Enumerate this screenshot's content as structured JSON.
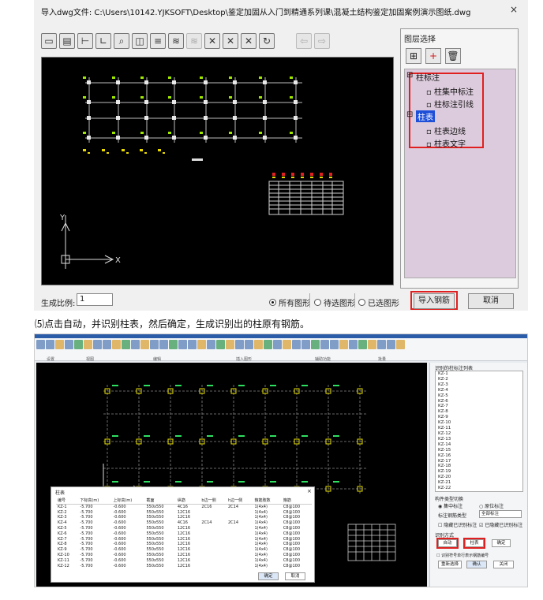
{
  "import_dialog": {
    "title": "导入dwg文件: C:\\Users\\10142.YJKSOFT\\Desktop\\鉴定加固从入门到精通系列课\\混凝土结构鉴定加固案例演示图纸.dwg",
    "close_glyph": "×",
    "layer_panel": {
      "title": "图层选择",
      "tool_icons": [
        "layer-pick-icon",
        "add-icon",
        "delete-icon"
      ],
      "tree": [
        {
          "label": "柱标注",
          "level": 0
        },
        {
          "label": "柱集中标注",
          "level": 1
        },
        {
          "label": "柱标注引线",
          "level": 1
        },
        {
          "label": "柱表",
          "level": 0,
          "selected": true
        },
        {
          "label": "柱表边线",
          "level": 1
        },
        {
          "label": "柱表文字",
          "level": 1
        }
      ]
    },
    "scale_label": "生成比例:",
    "scale_value": "1",
    "radio_options": [
      {
        "label": "所有图形",
        "checked": true
      },
      {
        "label": "待选图形",
        "checked": false
      },
      {
        "label": "已选图形",
        "checked": false
      }
    ],
    "import_button": "导入钢筋",
    "cancel_button": "取消",
    "highlight_color": "#e02020",
    "selection_color": "#1e4fd8"
  },
  "caption": "⑸点击自动，并识别柱表，然后确定，生成识别出的柱原有钢筋。",
  "app": {
    "ribbon_groups": [
      "设置",
      "视图",
      "编辑",
      "插入图形",
      "辅助功能",
      "批量"
    ],
    "side_panel": {
      "list_title": "识别的柱标注列表",
      "list_items": [
        "KZ-1",
        "KZ-2",
        "KZ-3",
        "KZ-4",
        "KZ-5",
        "KZ-6",
        "KZ-7",
        "KZ-8",
        "KZ-9",
        "KZ-10",
        "KZ-11",
        "KZ-12",
        "KZ-13",
        "KZ-14",
        "KZ-15",
        "KZ-16",
        "KZ-17",
        "KZ-18",
        "KZ-19",
        "KZ-20",
        "KZ-21",
        "KZ-22"
      ],
      "annotation_mode_label": "构件类型切换",
      "radio_a": "集中标注",
      "radio_b": "原位标注",
      "steel_label": "标注钢筋类型",
      "steel_value": "全部标注",
      "check_a": "隐藏已识别标注",
      "check_b": "已隐藏已识别标注",
      "recognize_label": "识别方式",
      "btn_auto": "自动",
      "btn_table": "柱表",
      "btn_ok": "确定",
      "check_c": "识别符号单行表示钢筋编号",
      "btn_reselect": "重新选择",
      "btn_confirm": "确认",
      "btn_close": "关闭"
    },
    "table_dialog": {
      "title": "柱表",
      "columns": [
        "编号",
        "下标高(m)",
        "上标高(m)",
        "截面",
        "纵筋",
        "b边一侧",
        "h边一侧",
        "箍筋肢数",
        "箍筋"
      ],
      "rows": [
        [
          "KZ-1",
          "-5.700",
          "-0.600",
          "550x550",
          "4C16",
          "2C16",
          "2C14",
          "1(4x4)",
          "C8@100"
        ],
        [
          "KZ-2",
          "-5.700",
          "-0.600",
          "550x550",
          "12C16",
          "",
          "",
          "1(4x4)",
          "C8@100"
        ],
        [
          "KZ-3",
          "-5.700",
          "-0.600",
          "550x550",
          "12C16",
          "",
          "",
          "1(4x4)",
          "C8@100"
        ],
        [
          "KZ-4",
          "-5.700",
          "-0.600",
          "550x550",
          "4C16",
          "2C14",
          "2C14",
          "1(4x4)",
          "C8@100"
        ],
        [
          "KZ-5",
          "-5.700",
          "-0.600",
          "550x550",
          "12C16",
          "",
          "",
          "1(4x4)",
          "C8@100"
        ],
        [
          "KZ-6",
          "-5.700",
          "-0.600",
          "550x550",
          "12C16",
          "",
          "",
          "1(4x4)",
          "C8@100"
        ],
        [
          "KZ-7",
          "-5.700",
          "-0.600",
          "550x550",
          "12C16",
          "",
          "",
          "1(4x4)",
          "C8@100"
        ],
        [
          "KZ-8",
          "-5.700",
          "-0.600",
          "550x550",
          "12C16",
          "",
          "",
          "1(4x4)",
          "C8@100"
        ],
        [
          "KZ-9",
          "-5.700",
          "-0.600",
          "550x550",
          "12C16",
          "",
          "",
          "1(4x4)",
          "C8@100"
        ],
        [
          "KZ-10",
          "-5.700",
          "-0.600",
          "550x550",
          "12C16",
          "",
          "",
          "1(4x4)",
          "C8@100"
        ],
        [
          "KZ-11",
          "-5.700",
          "-0.600",
          "550x550",
          "12C16",
          "",
          "",
          "1(4x4)",
          "C8@100"
        ],
        [
          "KZ-12",
          "-5.700",
          "-0.600",
          "550x550",
          "12C16",
          "",
          "",
          "1(4x4)",
          "C8@100"
        ]
      ],
      "ok": "确定",
      "cancel": "取消"
    }
  }
}
